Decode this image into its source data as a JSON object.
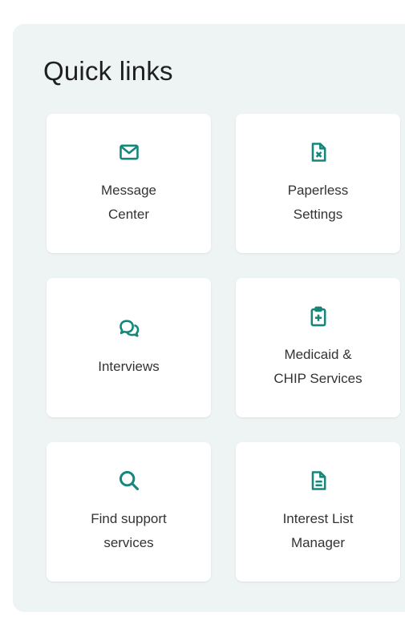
{
  "quick_links": {
    "title": "Quick links",
    "accent_color": "#14877a",
    "items": [
      {
        "label": "Message\nCenter",
        "icon": "envelope-icon"
      },
      {
        "label": "Paperless\nSettings",
        "icon": "paperless-document-icon"
      },
      {
        "label": "Interviews",
        "icon": "chat-bubbles-icon"
      },
      {
        "label": "Medicaid &\nCHIP Services",
        "icon": "medical-clipboard-icon"
      },
      {
        "label": "Find support\nservices",
        "icon": "search-icon"
      },
      {
        "label": "Interest List\nManager",
        "icon": "document-list-icon"
      }
    ]
  }
}
